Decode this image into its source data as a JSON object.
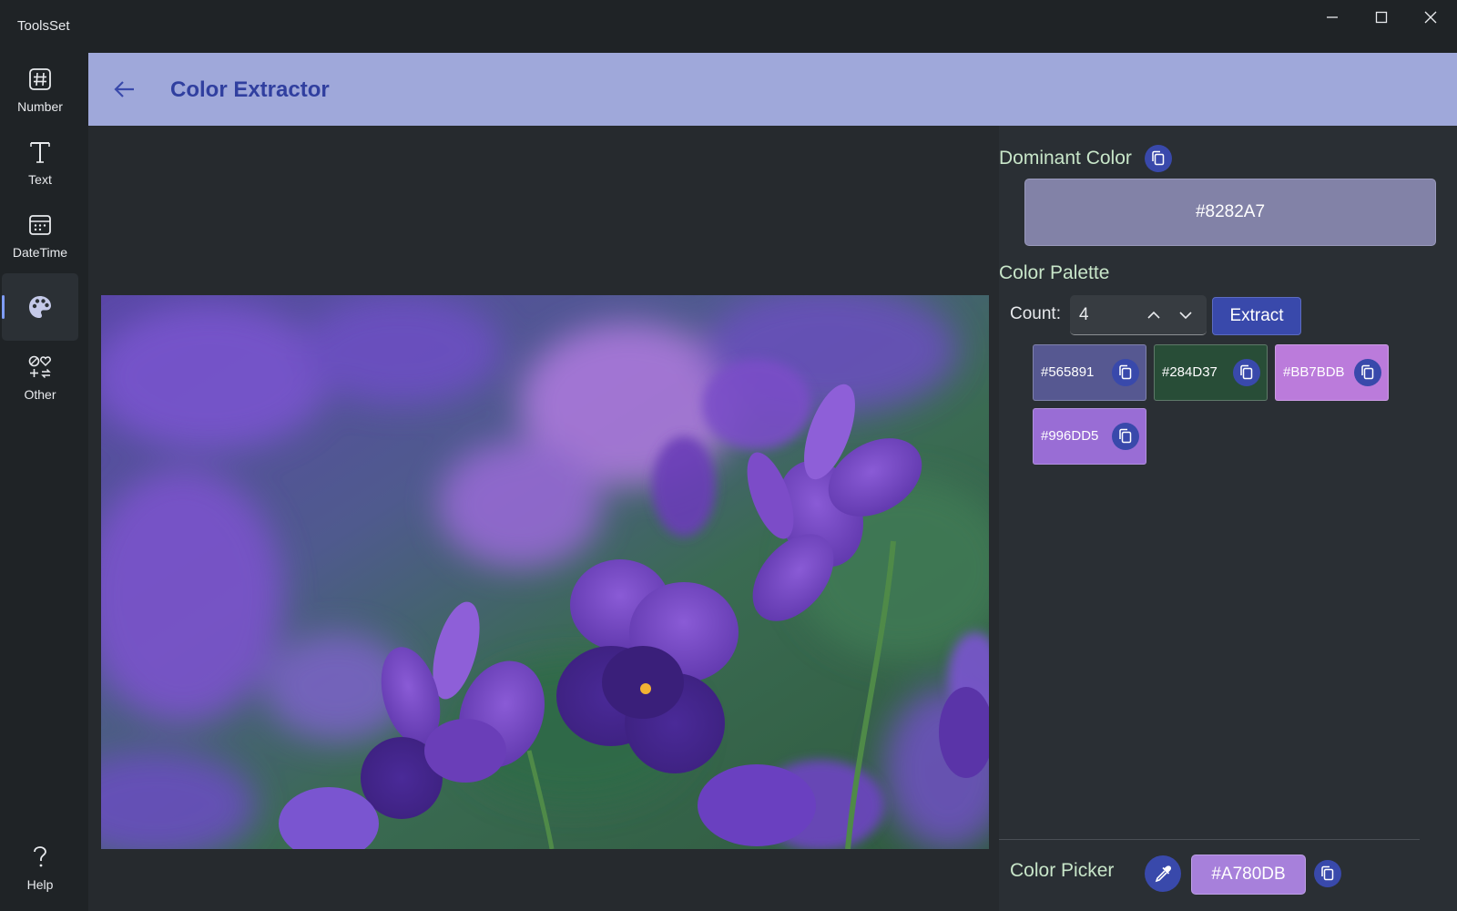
{
  "window": {
    "title": "ToolsSet",
    "minimize_label": "—",
    "maximize_label": "☐",
    "close_label": "✕"
  },
  "sidebar": {
    "items": [
      {
        "label": "Number",
        "icon": "hash-icon"
      },
      {
        "label": "Text",
        "icon": "text-t-icon"
      },
      {
        "label": "DateTime",
        "icon": "calendar-icon"
      },
      {
        "label": "",
        "icon": "palette-icon",
        "active": true
      },
      {
        "label": "Other",
        "icon": "shapes-icon"
      }
    ],
    "help_label": "Help",
    "help_icon": "question-icon"
  },
  "header": {
    "title": "Color Extractor",
    "back_icon": "back-arrow-icon"
  },
  "dominant": {
    "title": "Dominant Color",
    "value": "#8282A7",
    "color": "#8282A7"
  },
  "palette": {
    "title": "Color Palette",
    "count_label": "Count:",
    "count_value": "4",
    "extract_label": "Extract",
    "swatches": [
      {
        "hex": "#565891",
        "color": "#565891"
      },
      {
        "hex": "#284D37",
        "color": "#284D37"
      },
      {
        "hex": "#BB7BDB",
        "color": "#BB7BDB"
      },
      {
        "hex": "#996DD5",
        "color": "#996DD5"
      }
    ]
  },
  "picker": {
    "title": "Color Picker",
    "value": "#A780DB",
    "color": "#A780DB"
  },
  "colors": {
    "accent": "#3949AB",
    "header_bg": "#9FA8DA",
    "title_color": "#303F9F",
    "section_title": "#C8E6C9"
  }
}
